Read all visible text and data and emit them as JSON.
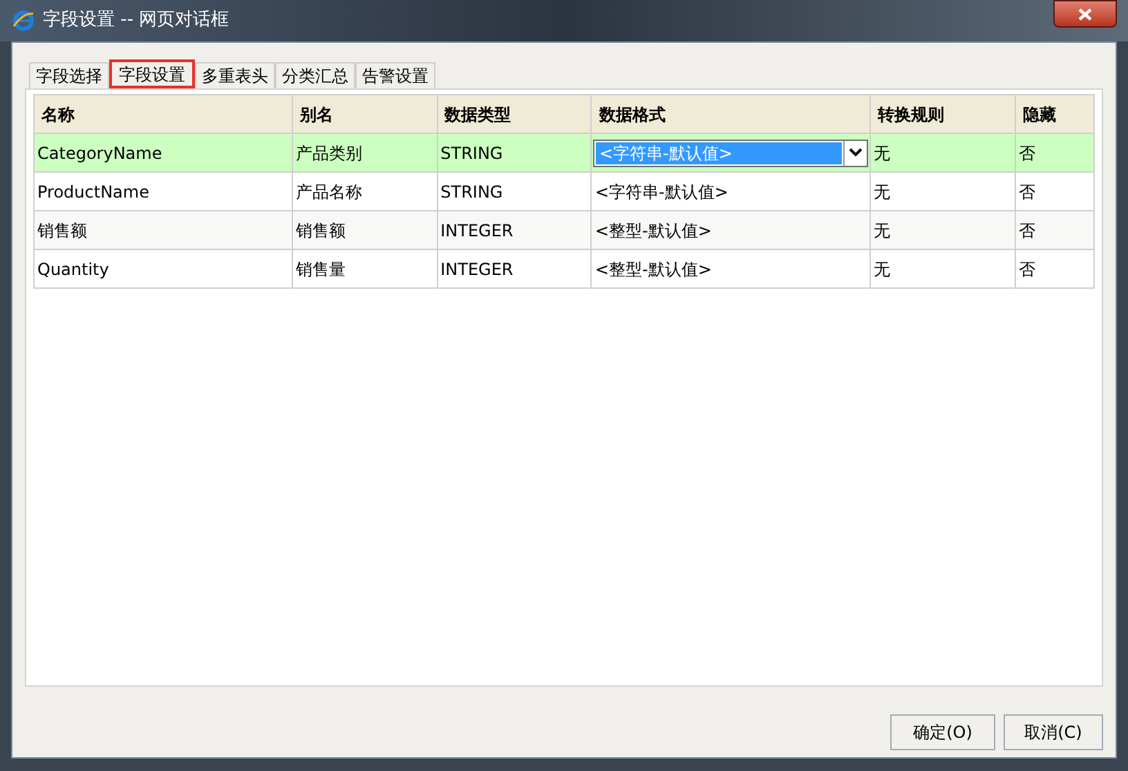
{
  "window": {
    "title": "字段设置 -- 网页对话框"
  },
  "tabs": [
    {
      "label": "字段选择",
      "selected": false
    },
    {
      "label": "字段设置",
      "selected": true
    },
    {
      "label": "多重表头",
      "selected": false
    },
    {
      "label": "分类汇总",
      "selected": false
    },
    {
      "label": "告警设置",
      "selected": false
    }
  ],
  "table": {
    "columns": [
      "名称",
      "别名",
      "数据类型",
      "数据格式",
      "转换规则",
      "隐藏"
    ],
    "rows": [
      {
        "selected": true,
        "cells": [
          "CategoryName",
          "产品类别",
          "STRING",
          "<字符串-默认值>",
          "无",
          "否"
        ]
      },
      {
        "selected": false,
        "cells": [
          "ProductName",
          "产品名称",
          "STRING",
          "<字符串-默认值>",
          "无",
          "否"
        ]
      },
      {
        "selected": false,
        "cells": [
          "销售额",
          "销售额",
          "INTEGER",
          "<整型-默认值>",
          "无",
          "否"
        ]
      },
      {
        "selected": false,
        "cells": [
          "Quantity",
          "销售量",
          "INTEGER",
          "<整型-默认值>",
          "无",
          "否"
        ]
      }
    ]
  },
  "buttons": [
    "确定(O)",
    "取消(C)"
  ]
}
